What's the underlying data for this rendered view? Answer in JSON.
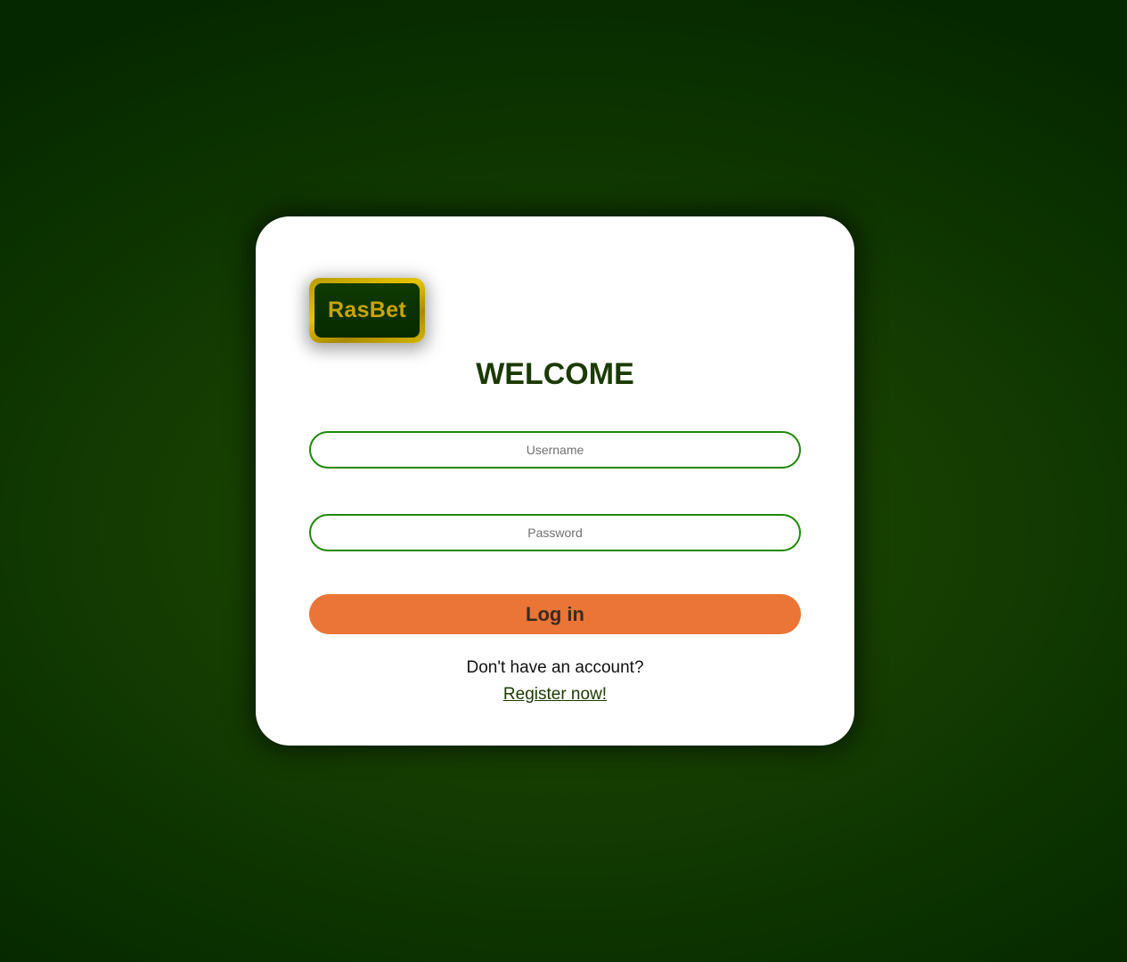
{
  "logo": {
    "text": "RasBet"
  },
  "heading": "WELCOME",
  "form": {
    "username_placeholder": "Username",
    "username_value": "",
    "password_placeholder": "Password",
    "password_value": "",
    "login_label": "Log in"
  },
  "footer": {
    "prompt": "Don't have an account?",
    "register_label": "Register now!"
  },
  "colors": {
    "background": "#153d02",
    "card": "#ffffff",
    "accent_orange": "#ea7537",
    "field_border": "#1f8a0a",
    "heading": "#1a3a02",
    "logo_gold": "#e6c400"
  }
}
